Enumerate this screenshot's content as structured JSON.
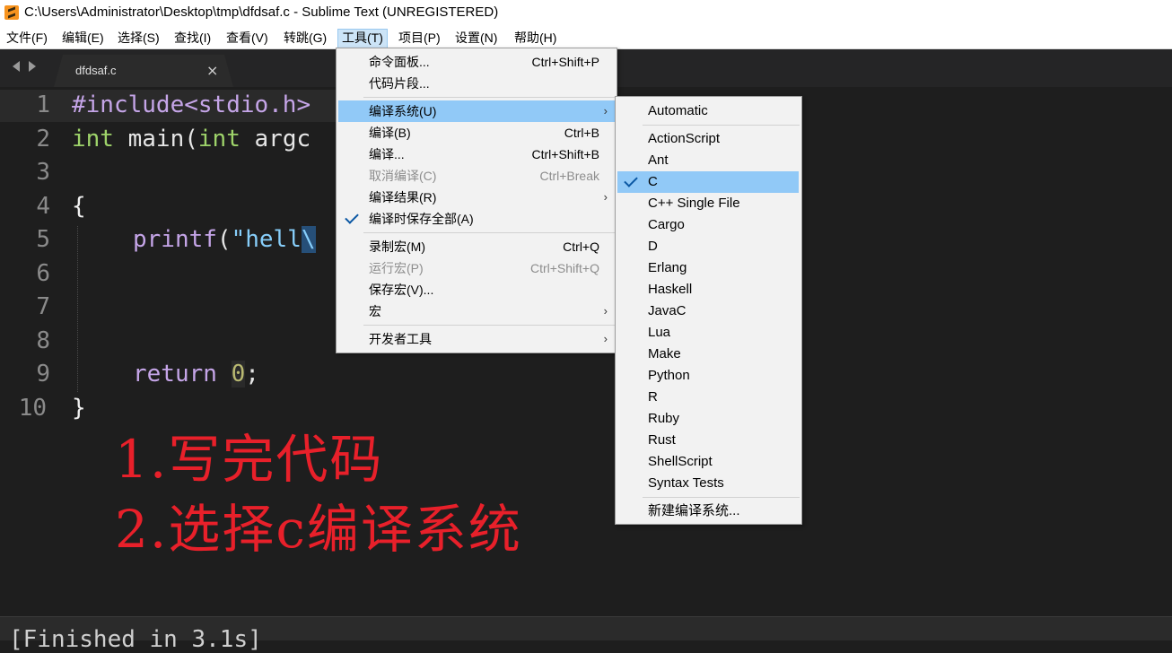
{
  "window": {
    "title": "C:\\Users\\Administrator\\Desktop\\tmp\\dfdsaf.c - Sublime Text (UNREGISTERED)"
  },
  "menubar": {
    "items": [
      "文件(F)",
      "编辑(E)",
      "选择(S)",
      "查找(I)",
      "查看(V)",
      "转跳(G)",
      "工具(T)",
      "项目(P)",
      "设置(N)",
      "帮助(H)"
    ],
    "active": "工具(T)"
  },
  "tab": {
    "label": "dfdsaf.c",
    "close": "×"
  },
  "editor": {
    "line_numbers": [
      "1",
      "2",
      "3",
      "4",
      "5",
      "6",
      "7",
      "8",
      "9",
      "10"
    ],
    "code": {
      "l1_kw": "#include",
      "l1_rest": "<stdio.h>",
      "l2_type": "int",
      "l2_name": " main(",
      "l2_type2": "int",
      "l2_rest": " argc",
      "l4": "{",
      "l5_fn": "printf",
      "l5_paren": "(",
      "l5_str": "\"hell",
      "l5_sel": "\\",
      "l9_kw": "return",
      "l9_num": "0",
      "l9_end": ";",
      "l10": "}"
    }
  },
  "annotations": {
    "step1": "1.写完代码",
    "step2": "2.选择c编译系统"
  },
  "output": {
    "text": "[Finished in 3.1s]"
  },
  "tools_menu": {
    "items": [
      {
        "label": "命令面板...",
        "shortcut": "Ctrl+Shift+P"
      },
      {
        "label": "代码片段...",
        "shortcut": ""
      },
      {
        "label": "编译系统(U)",
        "submenu": true,
        "highlighted": true
      },
      {
        "label": "编译(B)",
        "shortcut": "Ctrl+B"
      },
      {
        "label": "编译...",
        "shortcut": "Ctrl+Shift+B"
      },
      {
        "label": "取消编译(C)",
        "shortcut": "Ctrl+Break",
        "disabled": true
      },
      {
        "label": "编译结果(R)",
        "submenu": true
      },
      {
        "label": "编译时保存全部(A)",
        "checked": true
      },
      {
        "label": "录制宏(M)",
        "shortcut": "Ctrl+Q"
      },
      {
        "label": "运行宏(P)",
        "shortcut": "Ctrl+Shift+Q",
        "disabled": true
      },
      {
        "label": "保存宏(V)...",
        "shortcut": ""
      },
      {
        "label": "宏",
        "submenu": true
      },
      {
        "label": "开发者工具",
        "submenu": true
      }
    ]
  },
  "build_menu": {
    "items": [
      "Automatic",
      "ActionScript",
      "Ant",
      "C",
      "C++ Single File",
      "Cargo",
      "D",
      "Erlang",
      "Haskell",
      "JavaC",
      "Lua",
      "Make",
      "Python",
      "R",
      "Ruby",
      "Rust",
      "ShellScript",
      "Syntax Tests",
      "新建编译系统..."
    ],
    "selected": "C"
  },
  "colors": {
    "accent_highlight": "#91c9f7",
    "annotation_red": "#e8202a",
    "editor_bg": "#1e1e1e"
  }
}
